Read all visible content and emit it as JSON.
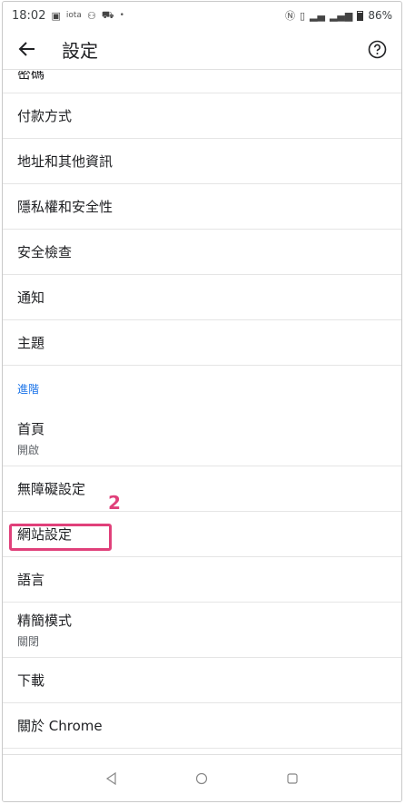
{
  "status_bar": {
    "time": "18:02",
    "left_icons": [
      "image-icon",
      "iota",
      "team-icon",
      "bus-icon",
      "•"
    ],
    "battery": "86%"
  },
  "app_bar": {
    "title": "設定"
  },
  "settings_items": [
    {
      "label": "密碼",
      "sub": ""
    },
    {
      "label": "付款方式",
      "sub": ""
    },
    {
      "label": "地址和其他資訊",
      "sub": ""
    },
    {
      "label": "隱私權和安全性",
      "sub": ""
    },
    {
      "label": "安全檢查",
      "sub": ""
    },
    {
      "label": "通知",
      "sub": ""
    },
    {
      "label": "主題",
      "sub": ""
    }
  ],
  "section_header": "進階",
  "advanced_items": [
    {
      "label": "首頁",
      "sub": "開啟"
    },
    {
      "label": "無障礙設定",
      "sub": ""
    },
    {
      "label": "網站設定",
      "sub": ""
    },
    {
      "label": "語言",
      "sub": ""
    },
    {
      "label": "精簡模式",
      "sub": "關閉"
    },
    {
      "label": "下載",
      "sub": ""
    },
    {
      "label": "關於 Chrome",
      "sub": ""
    }
  ],
  "annotation": {
    "step_number": "2",
    "color": "#e0407a"
  },
  "colors": {
    "section_header": "#1a73e8",
    "divider": "#e5e5e5"
  }
}
